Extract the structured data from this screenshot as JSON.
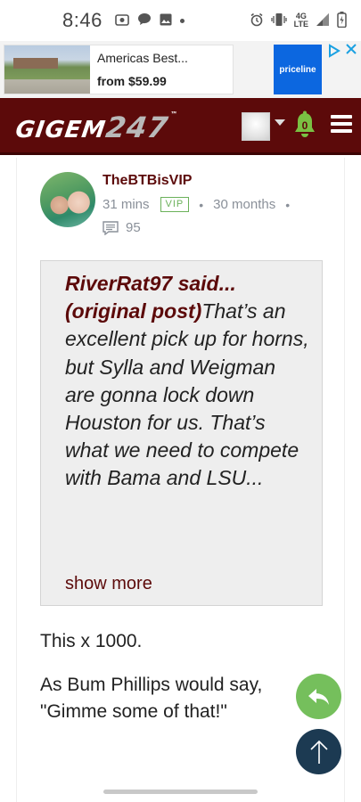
{
  "status_bar": {
    "time": "8:46",
    "network_label": "4G\nLTE",
    "battery_icon": "battery-charging-icon",
    "icons": [
      "camera-icon",
      "message-icon",
      "image-icon",
      "alarm-icon",
      "vibrate-icon",
      "signal-icon"
    ]
  },
  "ad": {
    "title": "Americas Best...",
    "price": "from $59.99",
    "brand": "priceline",
    "choices_icon": "ad-choices-icon",
    "close_icon": "close-icon"
  },
  "header": {
    "logo_text": "GIGEM",
    "logo_number": "247",
    "logo_tm": "™",
    "notification_count": "0",
    "colors": {
      "brand": "#5c0a0a",
      "bell": "#7ac143"
    }
  },
  "post": {
    "username": "TheBTBisVIP",
    "posted_ago": "31 mins",
    "badge": "VIP",
    "membership": "30 months",
    "comment_count": "95",
    "quote": {
      "author": "RiverRat97 said...",
      "link_label": "(original post)",
      "text": "That’s an excellent pick up for horns, but Sylla and Weigman are gonna lock down Houston for us. That’s what we need to compete with Bama and LSU...",
      "show_more": "show more"
    },
    "reply_paragraphs": [
      "This x 1000.",
      "As Bum Phillips would say, \"Gimme some of that!\""
    ]
  },
  "buttons": {
    "reply_icon": "reply-icon",
    "scroll_top_icon": "arrow-up-icon"
  }
}
